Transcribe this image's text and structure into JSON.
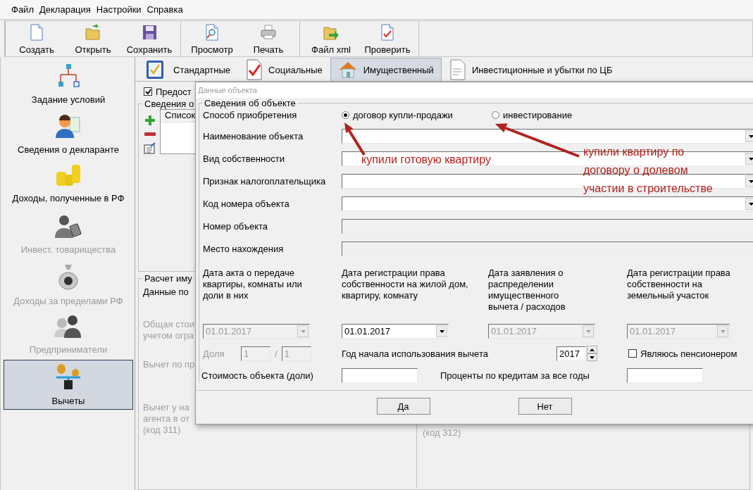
{
  "menu": [
    "Файл",
    "Декларация",
    "Настройки",
    "Справка"
  ],
  "toolbar": [
    [
      {
        "label": "Создать"
      },
      {
        "label": "Открыть"
      },
      {
        "label": "Сохранить"
      }
    ],
    [
      {
        "label": "Просмотр"
      },
      {
        "label": "Печать"
      }
    ],
    [
      {
        "label": "Файл xml"
      },
      {
        "label": "Проверить"
      }
    ]
  ],
  "sidebar": {
    "items": [
      {
        "label": "Задание условий",
        "selected": false,
        "disabled": false
      },
      {
        "label": "Сведения о декларанте",
        "selected": false,
        "disabled": false
      },
      {
        "label": "Доходы, полученные в РФ",
        "selected": false,
        "disabled": false
      },
      {
        "label": "Инвест. товарищества",
        "selected": false,
        "disabled": true
      },
      {
        "label": "Доходы за пределами РФ",
        "selected": false,
        "disabled": true
      },
      {
        "label": "Предприниматели",
        "selected": false,
        "disabled": true
      },
      {
        "label": "Вычеты",
        "selected": true,
        "disabled": false
      }
    ]
  },
  "tabs": [
    {
      "label": "Стандартные",
      "selected": false
    },
    {
      "label": "Социальные",
      "selected": false
    },
    {
      "label": "Имущественный",
      "selected": true
    },
    {
      "label": "Инвестиционные и убытки по ЦБ",
      "selected": false
    }
  ],
  "background": {
    "checkbox": {
      "label": "Предост",
      "checked": true
    },
    "list_group": "Сведения о",
    "list_header": "Список",
    "calc_group": "Расчет иму",
    "data_group": "Данные по",
    "left_texts": [
      [
        "Общая стои",
        "учетом огра"
      ],
      [
        "Вычет по пр"
      ],
      [
        "Вычет у на",
        "агента в от",
        "(код 311)"
      ]
    ],
    "right_text": "(код 312)"
  },
  "dialog": {
    "title": "Данные объекта",
    "group": "Сведения об объекте",
    "acquisition": {
      "label": "Способ приобретения",
      "options": [
        {
          "label": "договор купли-продажи",
          "selected": true
        },
        {
          "label": "инвестирование",
          "selected": false
        }
      ]
    },
    "fields": [
      {
        "label": "Наименование объекта",
        "kind": "select",
        "disabled": false
      },
      {
        "label": "Вид собственности",
        "kind": "select",
        "disabled": false
      },
      {
        "label": "Признак налогоплательщика",
        "kind": "select",
        "disabled": false
      },
      {
        "label": "Код номера объекта",
        "kind": "select",
        "disabled": false
      },
      {
        "label": "Номер объекта",
        "kind": "text",
        "disabled": true
      },
      {
        "label": "Место нахождения",
        "kind": "text",
        "disabled": true
      }
    ],
    "dates": [
      {
        "label": "Дата акта о передаче квартиры, комнаты или доли в них",
        "value": "01.01.2017",
        "disabled": true
      },
      {
        "label": "Дата регистрации права собственности на жилой дом, квартиру, комнату",
        "value": "01.01.2017",
        "disabled": false
      },
      {
        "label": "Дата заявления о распределении имущественного вычета / расходов",
        "value": "01.01.2017",
        "disabled": true
      },
      {
        "label": "Дата регистрации права собственности на земельный участок",
        "value": "01.01.2017",
        "disabled": true
      }
    ],
    "share": {
      "label": "Доля",
      "disabled": true,
      "numerator": "1",
      "separator": "/",
      "denominator": "1"
    },
    "start_year": {
      "label": "Год начала использования вычета",
      "value": "2017"
    },
    "pensioner": {
      "label": "Являюсь пенсионером",
      "checked": false
    },
    "cost": {
      "label": "Стоимость объекта (доли)"
    },
    "interest": {
      "label": "Проценты по кредитам за все годы"
    },
    "buttons": [
      "Да",
      "Нет"
    ]
  },
  "annotations": [
    {
      "lines": [
        "купили готовую квартиру"
      ]
    },
    {
      "lines": [
        "купили квартиру по",
        "договору о долевом",
        "участии в строительстве"
      ]
    }
  ]
}
